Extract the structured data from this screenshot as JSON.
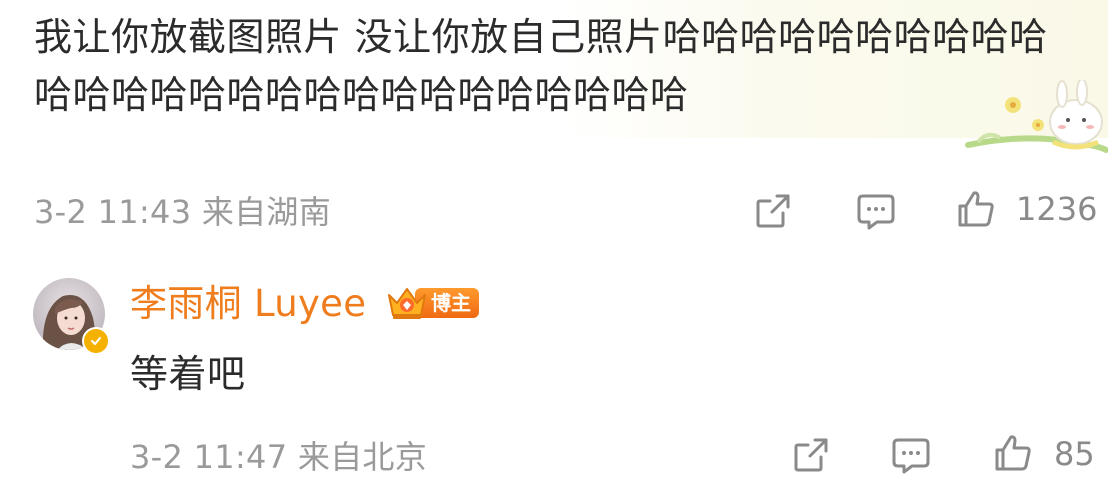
{
  "comment": {
    "text": "我让你放截图照片 没让你放自己照片哈哈哈哈哈哈哈哈哈哈哈哈哈哈哈哈哈哈哈哈哈哈哈哈哈哈哈",
    "time_location": "3-2 11:43 来自湖南",
    "like_count": "1236"
  },
  "reply": {
    "author": "李雨桐 Luyee",
    "badge_label": "博主",
    "text": "等着吧",
    "time_location": "3-2 11:47 来自北京",
    "like_count": "85"
  },
  "colors": {
    "author_name": "#ef7d1e",
    "badge": "#f06a12",
    "verified": "#f4b100",
    "meta_text": "#9a9a9a",
    "icon_stroke": "#8a8a8a",
    "sticker_background": "#faf9e8"
  },
  "icons": {
    "share": "share-icon",
    "comment": "comment-icon",
    "like": "thumbs-up-icon",
    "verified": "verified-icon",
    "crown": "crown-icon"
  }
}
